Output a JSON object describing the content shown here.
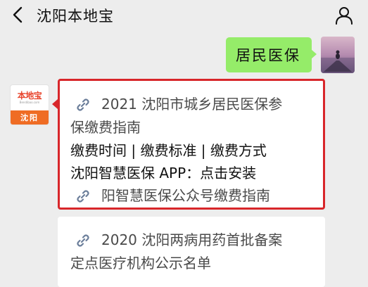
{
  "header": {
    "back_icon": "chevron-left-icon",
    "title": "沈阳本地宝",
    "profile_icon": "person-icon"
  },
  "outgoing": {
    "message": "居民医保",
    "bubble_color": "#95ec69"
  },
  "account": {
    "logo_text": "本地宝",
    "logo_url": "Bendibao.com",
    "city": "沈阳",
    "logo_color": "#e8442c",
    "band_color": "#ef6c24"
  },
  "reply_1": {
    "highlight_color": "#d8262a",
    "link_icon": "link-icon",
    "line_1": "2021 沈阳市城乡居民医保参",
    "line_2": "保缴费指南",
    "line_3": "缴费时间 | 缴费标准 | 缴费方式",
    "line_4": "沈阳智慧医保 APP：点击安装",
    "line_5": "阳智慧医保公众号缴费指南"
  },
  "reply_2": {
    "link_icon": "link-icon",
    "line_1": "2020 沈阳两病用药首批备案",
    "line_2": "定点医疗机构公示名单"
  }
}
